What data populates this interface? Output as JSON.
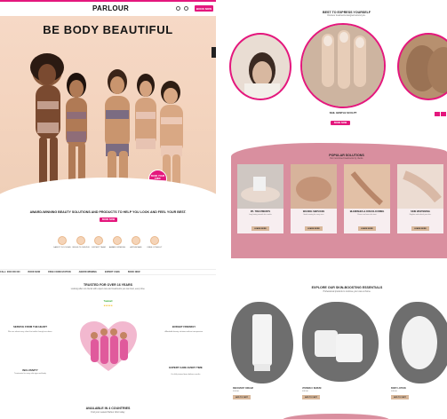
{
  "header": {
    "logo": "PARLOUR",
    "book_label": "BOOK NOW"
  },
  "hero": {
    "title": "BE BODY BEAUTIFUL",
    "badge": "BOOK YOUR FREE CONSULTATION"
  },
  "tagline": "AWARD-WINNING BEAUTY SOLUTIONS AND PRODUCTS TO HELP YOU LOOK AND FEEL YOUR BEST.",
  "tagline_button": "BOOK NOW",
  "icons": [
    {
      "name": "safety-icon",
      "label": "SAFETY FOCUSED"
    },
    {
      "name": "results-icon",
      "label": "RESULTS DRIVEN"
    },
    {
      "name": "expert-icon",
      "label": "EXPERT TEAM"
    },
    {
      "name": "award-icon",
      "label": "AWARD WINNING"
    },
    {
      "name": "care-icon",
      "label": "AFTERCARE"
    },
    {
      "name": "consult-icon",
      "label": "FREE CONSULT"
    }
  ],
  "ticker": [
    "CALL: 0000 000 000",
    "BOOK NOW",
    "FREE CONSULTATION",
    "AWARD WINNING",
    "EXPERT CARE",
    "BOOK NOW"
  ],
  "trusted": {
    "title": "TRUSTED FOR OVER 16 YEARS",
    "sub": "Looking after our clients with expert care and treatments you can trust, every time.",
    "rating_name": "Treatwell",
    "rating": "★★★★★"
  },
  "features": [
    {
      "title": "SERVICE FROM THE HEART",
      "desc": "We care about every client that walks through our doors."
    },
    {
      "title": "BUDGET FRIENDLY",
      "desc": "Affordable beauty solutions without compromise."
    },
    {
      "title": "INCLUSIVITY",
      "desc": "Treatments for every skin type and body."
    },
    {
      "title": "EXPERT CARE EVERY TIME",
      "desc": "Our fully trained team delivers results."
    }
  ],
  "available": {
    "title": "AVAILABLE IN 4 COUNTRIES",
    "sub": "Find your nearest Parlour clinic today."
  },
  "best": {
    "title": "BEST TO EXPRESS YOURSELF",
    "sub": "Discover treatments designed around you.",
    "item": "NAIL GENTLE SCULPT",
    "button": "BOOK NOW"
  },
  "popular": {
    "title": "POPULAR SOLUTIONS",
    "sub": "Our most loved treatments by clients.",
    "cards": [
      {
        "title": "IPL TREATMENTS",
        "desc": "Long lasting smooth skin results.",
        "button": "LEARN MORE"
      },
      {
        "title": "WAXING SERVICES",
        "desc": "Gentle waxing for every area.",
        "button": "LEARN MORE"
      },
      {
        "title": "BLEMISHES & DISCOLOURING",
        "desc": "Clearer and even skin tone.",
        "button": "LEARN MORE"
      },
      {
        "title": "SKIN WHITENING",
        "desc": "Brighten and refresh your skin.",
        "button": "LEARN MORE"
      }
    ]
  },
  "essentials": {
    "title": "EXPLORE OUR SKIN-BOOSTING ESSENTIALS",
    "sub": "Professional products to continue your care at home.",
    "products": [
      {
        "name": "RECOVERY CREAM",
        "price": "£24.00",
        "button": "ADD TO CART"
      },
      {
        "name": "VITAMIN C SERUM",
        "price": "£32.00",
        "button": "ADD TO CART"
      },
      {
        "name": "BODY LOTION",
        "price": "£28.00",
        "button": "ADD TO CART"
      }
    ]
  },
  "colors": {
    "brand": "#e4177d",
    "rose": "#d98f9f",
    "sand": "#d9b89b"
  }
}
